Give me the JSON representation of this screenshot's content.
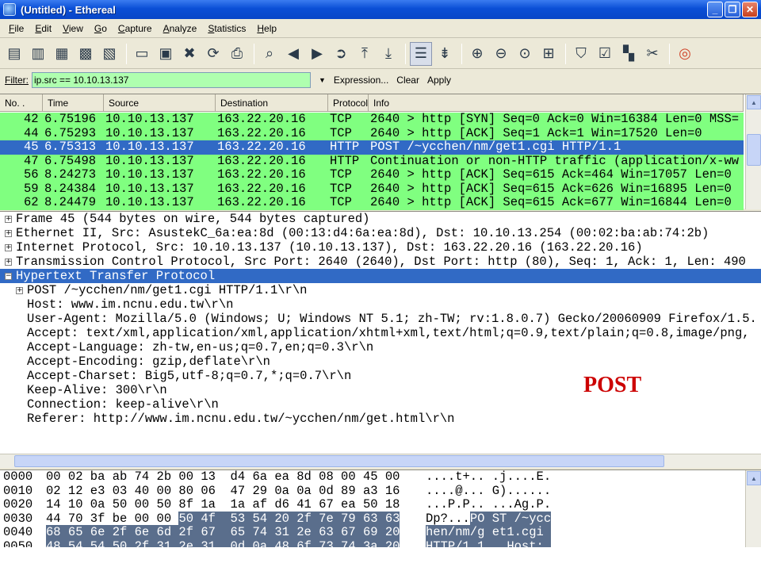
{
  "window": {
    "title": "(Untitled) - Ethereal",
    "buttons": [
      "_",
      "❐",
      "✕"
    ]
  },
  "menu": [
    "File",
    "Edit",
    "View",
    "Go",
    "Capture",
    "Analyze",
    "Statistics",
    "Help"
  ],
  "toolbar_icons": [
    "interface-list-icon",
    "capture-options-icon",
    "start-capture-icon",
    "stop-capture-icon",
    "restart-capture-icon",
    "open-file-icon",
    "save-file-icon",
    "close-file-icon",
    "reload-icon",
    "print-icon",
    "find-packet-icon",
    "go-back-icon",
    "go-forward-icon",
    "go-to-packet-icon",
    "go-first-icon",
    "go-last-icon",
    "colorize-icon",
    "autoscroll-icon",
    "zoom-in-icon",
    "zoom-out-icon",
    "zoom-normal-icon",
    "resize-columns-icon",
    "capture-filters-icon",
    "display-filters-icon",
    "coloring-rules-icon",
    "preferences-icon",
    "help-icon"
  ],
  "filter": {
    "label": "Filter:",
    "value": "ip.src == 10.10.13.137",
    "expression": "Expression...",
    "clear": "Clear",
    "apply": "Apply"
  },
  "packet_list": {
    "columns": [
      "No. .",
      "Time",
      "Source",
      "Destination",
      "Protocol",
      "Info"
    ],
    "rows": [
      {
        "no": "42",
        "time": "6.75196",
        "src": "10.10.13.137",
        "dst": "163.22.20.16",
        "proto": "TCP",
        "info": "2640 > http [SYN] Seq=0 Ack=0 Win=16384 Len=0 MSS="
      },
      {
        "no": "44",
        "time": "6.75293",
        "src": "10.10.13.137",
        "dst": "163.22.20.16",
        "proto": "TCP",
        "info": "2640 > http [ACK] Seq=1 Ack=1 Win=17520 Len=0"
      },
      {
        "no": "45",
        "time": "6.75313",
        "src": "10.10.13.137",
        "dst": "163.22.20.16",
        "proto": "HTTP",
        "info": "POST /~ycchen/nm/get1.cgi HTTP/1.1"
      },
      {
        "no": "47",
        "time": "6.75498",
        "src": "10.10.13.137",
        "dst": "163.22.20.16",
        "proto": "HTTP",
        "info": "Continuation or non-HTTP traffic (application/x-ww"
      },
      {
        "no": "56",
        "time": "8.24273",
        "src": "10.10.13.137",
        "dst": "163.22.20.16",
        "proto": "TCP",
        "info": "2640 > http [ACK] Seq=615 Ack=464 Win=17057 Len=0"
      },
      {
        "no": "59",
        "time": "8.24384",
        "src": "10.10.13.137",
        "dst": "163.22.20.16",
        "proto": "TCP",
        "info": "2640 > http [ACK] Seq=615 Ack=626 Win=16895 Len=0"
      },
      {
        "no": "62",
        "time": "8.24479",
        "src": "10.10.13.137",
        "dst": "163.22.20.16",
        "proto": "TCP",
        "info": "2640 > http [ACK] Seq=615 Ack=677 Win=16844 Len=0"
      }
    ]
  },
  "details": {
    "top": [
      "Frame 45 (544 bytes on wire, 544 bytes captured)",
      "Ethernet II, Src: AsustekC_6a:ea:8d (00:13:d4:6a:ea:8d), Dst: 10.10.13.254 (00:02:ba:ab:74:2b)",
      "Internet Protocol, Src: 10.10.13.137 (10.10.13.137), Dst: 163.22.20.16 (163.22.20.16)",
      "Transmission Control Protocol, Src Port: 2640 (2640), Dst Port: http (80), Seq: 1, Ack: 1, Len: 490"
    ],
    "http_header": "Hypertext Transfer Protocol",
    "post_line": "POST /~ycchen/nm/get1.cgi HTTP/1.1\\r\\n",
    "http_lines": [
      "Host: www.im.ncnu.edu.tw\\r\\n",
      "User-Agent: Mozilla/5.0 (Windows; U; Windows NT 5.1; zh-TW; rv:1.8.0.7) Gecko/20060909 Firefox/1.5.",
      "Accept: text/xml,application/xml,application/xhtml+xml,text/html;q=0.9,text/plain;q=0.8,image/png,",
      "Accept-Language: zh-tw,en-us;q=0.7,en;q=0.3\\r\\n",
      "Accept-Encoding: gzip,deflate\\r\\n",
      "Accept-Charset: Big5,utf-8;q=0.7,*;q=0.7\\r\\n",
      "Keep-Alive: 300\\r\\n",
      "Connection: keep-alive\\r\\n",
      "Referer: http://www.im.ncnu.edu.tw/~ycchen/nm/get.html\\r\\n"
    ],
    "annotation": "POST",
    "plus": "+",
    "minus": "−"
  },
  "hex": [
    {
      "off": "0000",
      "b1": "00 02 ba ab 74 2b 00 13  d4 6a ea 8d 08 00 45 00",
      "b2": "",
      "a1": "....t+.. .j....E.",
      "a2": ""
    },
    {
      "off": "0010",
      "b1": "02 12 e3 03 40 00 80 06  47 29 0a 0a 0d 89 a3 16",
      "b2": "",
      "a1": "....@... G)......",
      "a2": ""
    },
    {
      "off": "0020",
      "b1": "14 10 0a 50 00 50 8f 1a  1a af d6 41 67 ea 50 18",
      "b2": "",
      "a1": "...P.P.. ...Ag.P.",
      "a2": ""
    },
    {
      "off": "0030",
      "b1": "44 70 3f be 00 00 ",
      "b2": "50 4f  53 54 20 2f 7e 79 63 63",
      "a1": "Dp?...",
      "a2": "PO ST /~ycc"
    },
    {
      "off": "0040",
      "b1": "",
      "b2": "68 65 6e 2f 6e 6d 2f 67  65 74 31 2e 63 67 69 20",
      "a1": "",
      "a2": "hen/nm/g et1.cgi "
    },
    {
      "off": "0050",
      "b1": "",
      "b2": "48 54 54 50 2f 31 2e 31  0d 0a 48 6f 73 74 3a 20",
      "a1": "",
      "a2": "HTTP/1.1 ..Host: "
    }
  ]
}
